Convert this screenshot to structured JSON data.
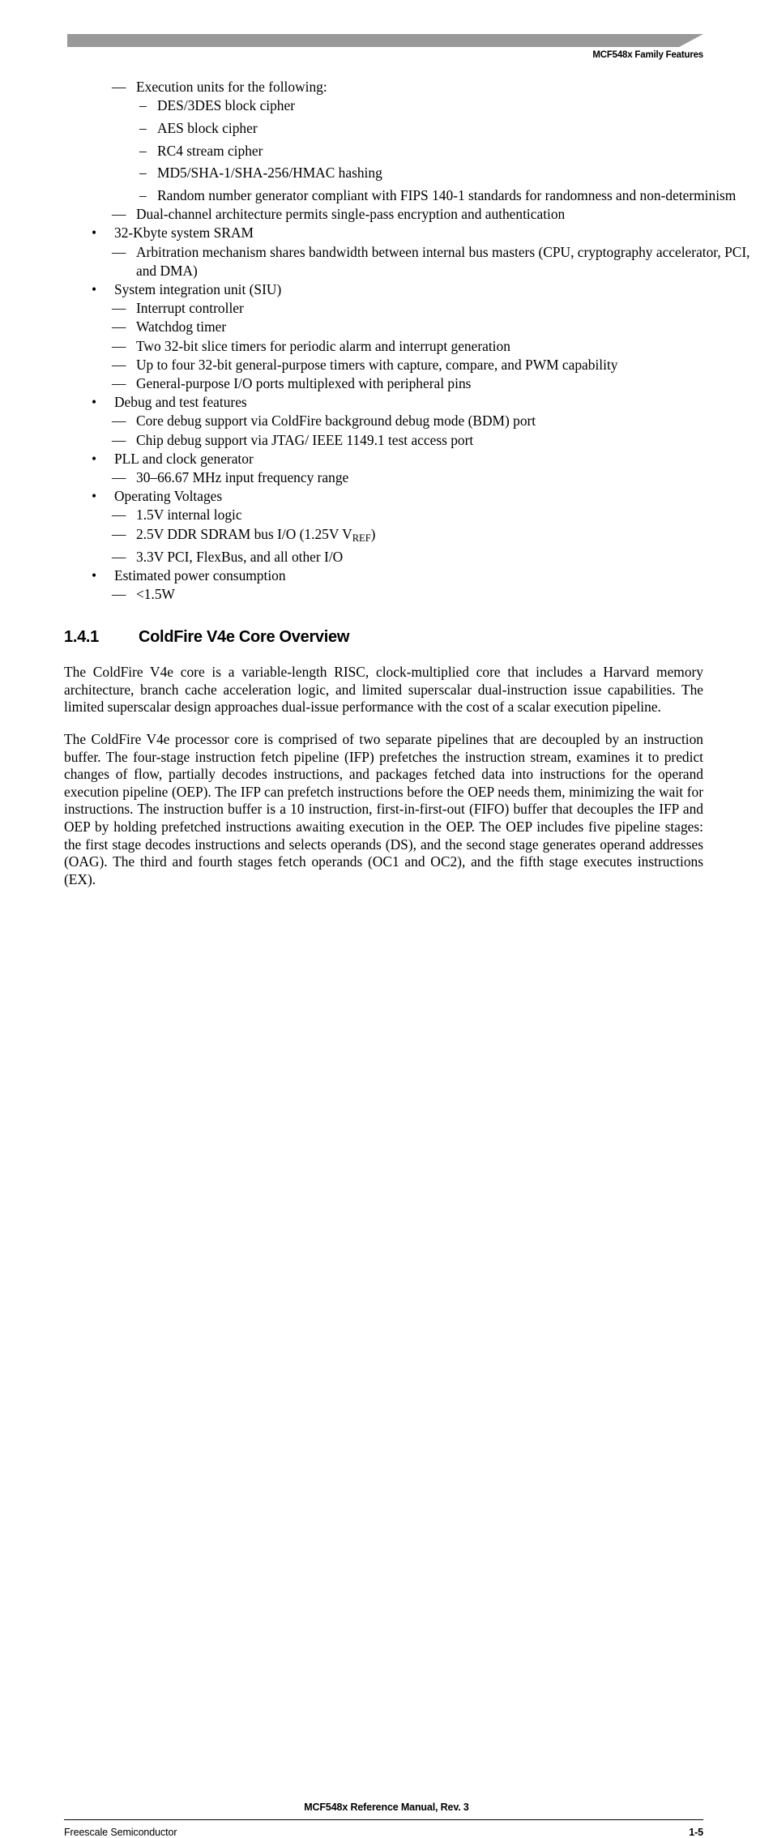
{
  "header": {
    "title": "MCF548x Family Features",
    "bar_color": "#999999"
  },
  "bullets": [
    {
      "level": 2,
      "marker": "—",
      "text": "Execution units for the following:"
    },
    {
      "level": 3,
      "marker": "–",
      "text": "DES/3DES block cipher"
    },
    {
      "level": 3,
      "marker": "–",
      "text": "AES block cipher"
    },
    {
      "level": 3,
      "marker": "–",
      "text": "RC4 stream cipher"
    },
    {
      "level": 3,
      "marker": "–",
      "text": "MD5/SHA-1/SHA-256/HMAC hashing"
    },
    {
      "level": 3,
      "marker": "–",
      "text": "Random number generator compliant with FIPS 140-1 standards for randomness and non-determinism"
    },
    {
      "level": 2,
      "marker": "—",
      "text": "Dual-channel architecture permits single-pass encryption and authentication"
    },
    {
      "level": 1,
      "marker": "•",
      "text": "32-Kbyte system SRAM"
    },
    {
      "level": 2,
      "marker": "—",
      "text": "Arbitration mechanism shares bandwidth between internal bus masters (CPU, cryptography accelerator, PCI, and DMA)"
    },
    {
      "level": 1,
      "marker": "•",
      "text": "System integration unit (SIU)"
    },
    {
      "level": 2,
      "marker": "—",
      "text": "Interrupt controller"
    },
    {
      "level": 2,
      "marker": "—",
      "text": "Watchdog timer"
    },
    {
      "level": 2,
      "marker": "—",
      "text": "Two 32-bit slice timers for periodic alarm and interrupt generation"
    },
    {
      "level": 2,
      "marker": "—",
      "text": "Up to four 32-bit general-purpose timers with capture, compare, and PWM capability"
    },
    {
      "level": 2,
      "marker": "—",
      "text": "General-purpose I/O ports multiplexed with peripheral pins"
    },
    {
      "level": 1,
      "marker": "•",
      "text": "Debug and test features"
    },
    {
      "level": 2,
      "marker": "—",
      "text": "Core debug support via ColdFire background debug mode (BDM) port"
    },
    {
      "level": 2,
      "marker": "—",
      "text": "Chip debug support via JTAG/ IEEE 1149.1 test access port"
    },
    {
      "level": 1,
      "marker": "•",
      "text": "PLL and clock generator"
    },
    {
      "level": 2,
      "marker": "—",
      "text": "30–66.67 MHz input frequency range"
    },
    {
      "level": 1,
      "marker": "•",
      "text": "Operating Voltages"
    },
    {
      "level": 2,
      "marker": "—",
      "text": "1.5V internal logic"
    },
    {
      "level": 2,
      "marker": "—",
      "text": "2.5V DDR SDRAM bus I/O (1.25V VREF)",
      "html": "2.5V DDR SDRAM bus I/O (1.25V V<sub>REF</sub>)"
    },
    {
      "level": 2,
      "marker": "—",
      "text": "3.3V PCI, FlexBus, and all other I/O"
    },
    {
      "level": 1,
      "marker": "•",
      "text": "Estimated power consumption"
    },
    {
      "level": 2,
      "marker": "—",
      "text": "<1.5W"
    }
  ],
  "section": {
    "number": "1.4.1",
    "title": "ColdFire V4e Core Overview"
  },
  "paragraphs": [
    "The ColdFire V4e core is a variable-length RISC, clock-multiplied core that includes a Harvard memory architecture, branch cache acceleration logic, and limited superscalar dual-instruction issue capabilities. The limited superscalar design approaches dual-issue performance with the cost of a scalar execution pipeline.",
    "The ColdFire V4e processor core is comprised of two separate pipelines that are decoupled by an instruction buffer. The four-stage instruction fetch pipeline (IFP) prefetches the instruction stream, examines it to predict changes of flow, partially decodes instructions, and packages fetched data into instructions for the operand execution pipeline (OEP). The IFP can prefetch instructions before the OEP needs them, minimizing the wait for instructions. The instruction buffer is a 10 instruction, first-in-first-out (FIFO) buffer that decouples the IFP and OEP by holding prefetched instructions awaiting execution in the OEP. The OEP includes five pipeline stages: the first stage decodes instructions and selects operands (DS), and the second stage generates operand addresses (OAG). The third and fourth stages fetch operands (OC1 and OC2), and the fifth stage executes instructions (EX)."
  ],
  "footer": {
    "title": "MCF548x Reference Manual, Rev. 3",
    "company": "Freescale Semiconductor",
    "page_number": "1-5"
  }
}
